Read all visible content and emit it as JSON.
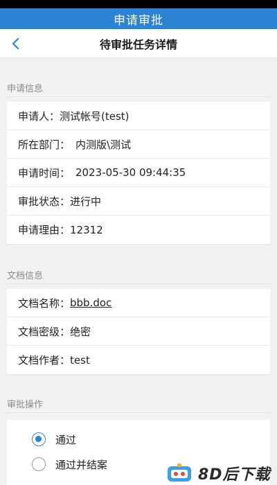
{
  "app_bar": {
    "title": "申请审批"
  },
  "nav": {
    "title": "待审批任务详情"
  },
  "apply_info": {
    "header": "申请信息",
    "rows": [
      {
        "label": "申请人：",
        "value": "测试帐号(test)"
      },
      {
        "label": "所在部门：",
        "value": "内测版\\测试"
      },
      {
        "label": "申请时间：",
        "value": "2023-05-30 09:44:35"
      },
      {
        "label": "审批状态：",
        "value": "进行中"
      },
      {
        "label": "申请理由：",
        "value": "12312"
      }
    ]
  },
  "doc_info": {
    "header": "文档信息",
    "rows": [
      {
        "label": "文档名称：",
        "value": "bbb.doc"
      },
      {
        "label": "文档密级：",
        "value": "绝密"
      },
      {
        "label": "文档作者：",
        "value": "test"
      }
    ]
  },
  "approval": {
    "header": "审批操作",
    "options": [
      {
        "label": "通过",
        "selected": true
      },
      {
        "label": "通过并结案",
        "selected": false
      }
    ]
  },
  "watermark": {
    "text": "8D后下载"
  },
  "colors": {
    "accent": "#2b83d4",
    "background": "#f2f2f4"
  }
}
